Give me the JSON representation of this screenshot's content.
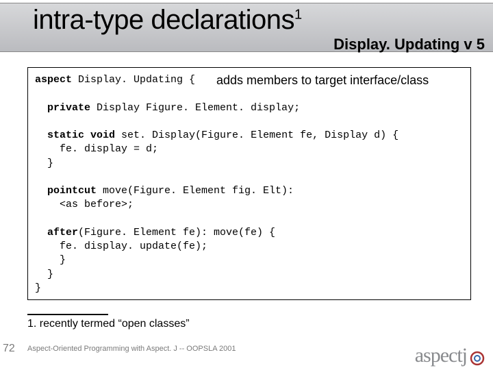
{
  "title": {
    "text": "intra-type declarations",
    "sup": "1"
  },
  "subtitle": "Display. Updating v 5",
  "annotation": "adds members to target interface/class",
  "code": {
    "l1a": "aspect",
    "l1b": " Display. Updating {",
    "l2": "",
    "l3a": "  private",
    "l3b": " Display Figure. Element. display;",
    "l4": "",
    "l5a": "  static void",
    "l5b": " set. Display(Figure. Element fe, Display d) {",
    "l6": "    fe. display = d;",
    "l7": "  }",
    "l8": "",
    "l9a": "  pointcut",
    "l9b": " move(Figure. Element fig. Elt):",
    "l10": "    <as before>;",
    "l11": "",
    "l12a": "  after",
    "l12b": "(Figure. Element fe): move(fe) {",
    "l13": "    fe. display. update(fe);",
    "l14": "    }",
    "l15": "  }",
    "l16": "}"
  },
  "footnote": "1. recently termed “open classes”",
  "slide_number": "72",
  "credit": "Aspect-Oriented Programming with Aspect. J -- OOPSLA 2001",
  "logo": {
    "text": "aspectj"
  }
}
